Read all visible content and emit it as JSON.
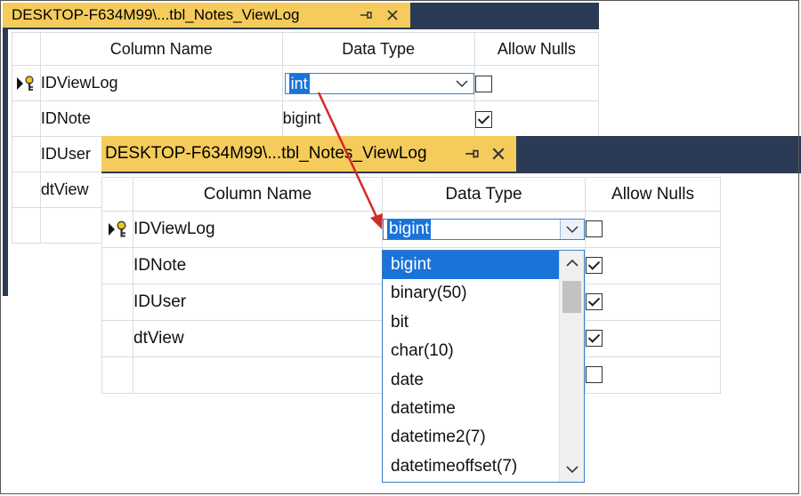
{
  "back_window": {
    "tab_title": "DESKTOP-F634M99\\...tbl_Notes_ViewLog",
    "columns": {
      "name": "Column Name",
      "type": "Data Type",
      "nulls": "Allow Nulls"
    },
    "rows": [
      {
        "name": "IDViewLog",
        "type": "int",
        "nulls": false
      },
      {
        "name": "IDNote",
        "type": "bigint",
        "nulls": true
      },
      {
        "name": "IDUser",
        "type": "",
        "nulls": null
      },
      {
        "name": "dtView",
        "type": "",
        "nulls": null
      }
    ]
  },
  "front_window": {
    "tab_title": "DESKTOP-F634M99\\...tbl_Notes_ViewLog",
    "columns": {
      "name": "Column Name",
      "type": "Data Type",
      "nulls": "Allow Nulls"
    },
    "rows": [
      {
        "name": "IDViewLog",
        "type": "bigint",
        "nulls": false
      },
      {
        "name": "IDNote",
        "type": "",
        "nulls": true
      },
      {
        "name": "IDUser",
        "type": "",
        "nulls": true
      },
      {
        "name": "dtView",
        "type": "",
        "nulls": true
      },
      {
        "name": "",
        "type": "",
        "nulls": false
      }
    ],
    "dropdown_options": [
      "bigint",
      "binary(50)",
      "bit",
      "char(10)",
      "date",
      "datetime",
      "datetime2(7)",
      "datetimeoffset(7)"
    ],
    "dropdown_selected": "bigint"
  },
  "colors": {
    "titlebar": "#2b3a55",
    "tab": "#f5cc5b",
    "selection": "#1a73d9",
    "arrow": "#d42a2a"
  }
}
